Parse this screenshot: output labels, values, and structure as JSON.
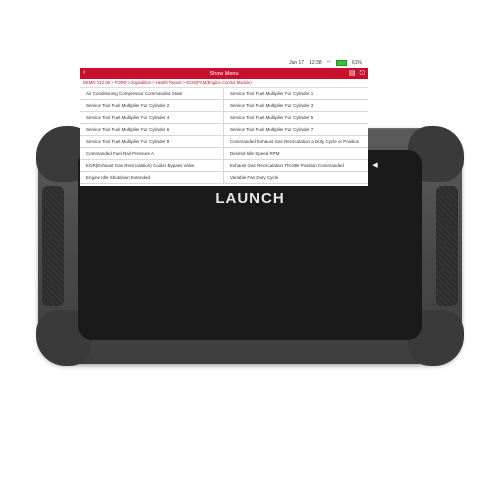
{
  "status": {
    "date": "Jun 17",
    "time": "12:38",
    "battery": "61%"
  },
  "titlebar": {
    "title": "Show Menu",
    "back": "‹",
    "report_icon": "▤",
    "exit_icon": "⎋"
  },
  "breadcrumb": "DEMO V12.06 > FORD > Expedition > Health Report > ECM(PCM(Engine Control Module)",
  "rows": [
    [
      "Air Conditioning Compressor Commanded State",
      "Service Tool Fuel Multiplier For Cylinder 1"
    ],
    [
      "Service Tool Fuel Multiplier For Cylinder 2",
      "Service Tool Fuel Multiplier For Cylinder 3"
    ],
    [
      "Service Tool Fuel Multiplier For Cylinder 4",
      "Service Tool Fuel Multiplier For Cylinder 5"
    ],
    [
      "Service Tool Fuel Multiplier For Cylinder 6",
      "Service Tool Fuel Multiplier For Cylinder 7"
    ],
    [
      "Service Tool Fuel Multiplier For Cylinder 8",
      "Commanded Exhaust Gas Recirculation a Duty Cycle or Position"
    ],
    [
      "Commanded Fuel Rail Pressure A",
      "Desired Idle Speed RPM"
    ],
    [
      "EGR(Exhaust Gas Recirculation) Cooler Bypass Valve",
      "Exhaust Gas Recirculation Throttle Position Commanded"
    ],
    [
      "Engine Idle Shutdown Extended",
      "Variable Fan Duty Cycle"
    ]
  ],
  "side_buttons": {
    "dot": "●",
    "gallery": "▣",
    "back": "◀"
  },
  "brand": "LAUNCH"
}
